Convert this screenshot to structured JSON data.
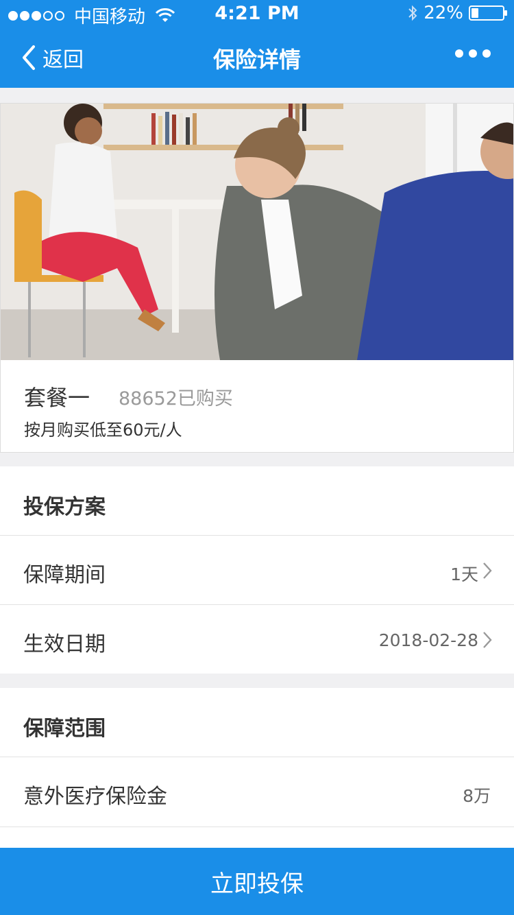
{
  "status_bar": {
    "carrier": "中国移动",
    "time": "4:21 PM",
    "battery_percent": "22%",
    "battery_level": 0.22,
    "signal_bars": 3
  },
  "nav": {
    "back_label": "返回",
    "title": "保险详情",
    "back_icon": "chevron-left-icon",
    "more_icon": "more-dots-icon"
  },
  "product": {
    "plan_name": "套餐一",
    "sold_count": "88652已购买",
    "price_desc": "按月购买低至60元/人"
  },
  "plan_section": {
    "title": "投保方案",
    "rows": [
      {
        "label": "保障期间",
        "value": "1天"
      },
      {
        "label": "生效日期",
        "value": "2018-02-28"
      }
    ]
  },
  "coverage_section": {
    "title": "保障范围",
    "rows": [
      {
        "label": "意外医疗保险金",
        "value": "8万"
      }
    ]
  },
  "cta": {
    "label": "立即投保"
  },
  "colors": {
    "primary": "#1a8ee8",
    "background": "#f0f0f2",
    "text_primary": "#333333",
    "text_secondary": "#9a9a9a"
  }
}
